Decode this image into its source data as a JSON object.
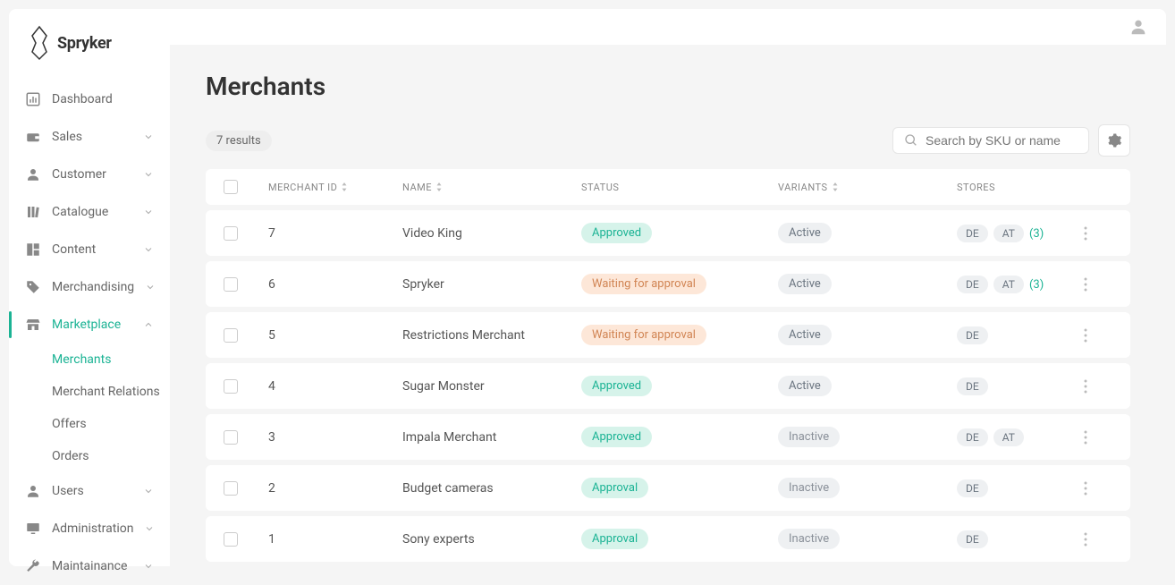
{
  "brand": "Spryker",
  "sidebar": {
    "items": [
      {
        "label": "Dashboard",
        "icon": "chart"
      },
      {
        "label": "Sales",
        "icon": "wallet",
        "expandable": true
      },
      {
        "label": "Customer",
        "icon": "user",
        "expandable": true
      },
      {
        "label": "Catalogue",
        "icon": "books",
        "expandable": true
      },
      {
        "label": "Content",
        "icon": "layout",
        "expandable": true
      },
      {
        "label": "Merchandising",
        "icon": "tag",
        "expandable": true
      },
      {
        "label": "Marketplace",
        "icon": "store",
        "expandable": true,
        "active": true
      },
      {
        "label": "Users",
        "icon": "user",
        "expandable": true
      },
      {
        "label": "Administration",
        "icon": "monitor",
        "expandable": true
      },
      {
        "label": "Maintainance",
        "icon": "wrench",
        "expandable": true
      }
    ],
    "sub": [
      {
        "label": "Merchants",
        "active": true
      },
      {
        "label": "Merchant Relations"
      },
      {
        "label": "Offers"
      },
      {
        "label": "Orders"
      }
    ]
  },
  "page": {
    "title": "Merchants",
    "results": "7 results",
    "search_placeholder": "Search by SKU or name",
    "columns": {
      "id": "Merchant ID",
      "name": "Name",
      "status": "Status",
      "variants": "Variants",
      "stores": "Stores"
    }
  },
  "rows": [
    {
      "id": "7",
      "name": "Video King",
      "status": "Approved",
      "status_class": "approved",
      "variant": "Active",
      "variant_class": "active",
      "stores": [
        "DE",
        "AT"
      ],
      "more": "(3)"
    },
    {
      "id": "6",
      "name": "Spryker",
      "status": "Waiting for approval",
      "status_class": "waiting",
      "variant": "Active",
      "variant_class": "active",
      "stores": [
        "DE",
        "AT"
      ],
      "more": "(3)"
    },
    {
      "id": "5",
      "name": "Restrictions Merchant",
      "status": "Waiting for approval",
      "status_class": "waiting",
      "variant": "Active",
      "variant_class": "active",
      "stores": [
        "DE"
      ]
    },
    {
      "id": "4",
      "name": "Sugar Monster",
      "status": "Approved",
      "status_class": "approved",
      "variant": "Active",
      "variant_class": "active",
      "stores": [
        "DE"
      ]
    },
    {
      "id": "3",
      "name": "Impala Merchant",
      "status": "Approved",
      "status_class": "approved",
      "variant": "Inactive",
      "variant_class": "inactive",
      "stores": [
        "DE",
        "AT"
      ]
    },
    {
      "id": "2",
      "name": "Budget cameras",
      "status": "Approval",
      "status_class": "approval",
      "variant": "Inactive",
      "variant_class": "inactive",
      "stores": [
        "DE"
      ]
    },
    {
      "id": "1",
      "name": "Sony experts",
      "status": "Approval",
      "status_class": "approval",
      "variant": "Inactive",
      "variant_class": "inactive",
      "stores": [
        "DE"
      ]
    }
  ]
}
